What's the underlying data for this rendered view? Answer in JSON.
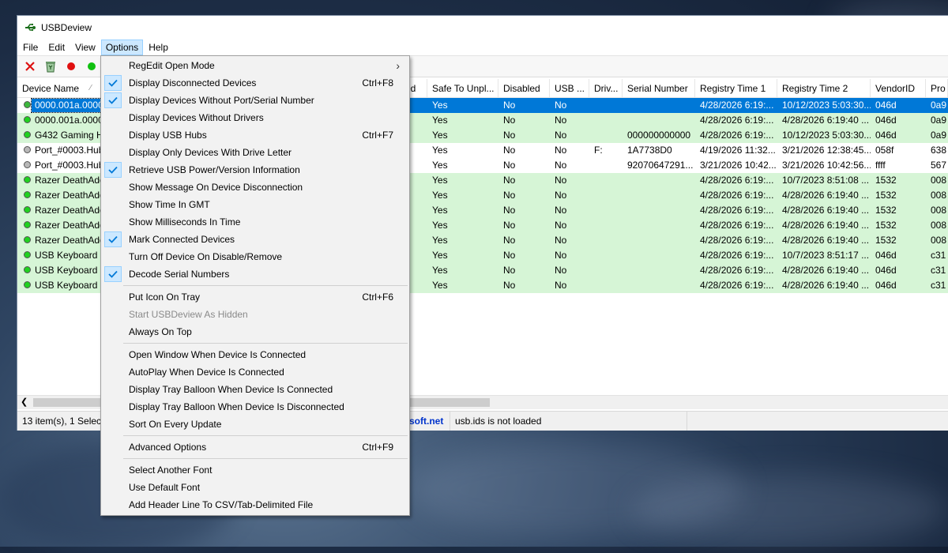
{
  "window": {
    "title": "USBDeview"
  },
  "menubar": [
    {
      "label": "File",
      "active": false
    },
    {
      "label": "Edit",
      "active": false
    },
    {
      "label": "View",
      "active": false
    },
    {
      "label": "Options",
      "active": true
    },
    {
      "label": "Help",
      "active": false
    }
  ],
  "columns": [
    {
      "label": "Device Name"
    },
    {
      "label": "ed"
    },
    {
      "label": "Safe To Unpl..."
    },
    {
      "label": "Disabled"
    },
    {
      "label": "USB ..."
    },
    {
      "label": "Driv..."
    },
    {
      "label": "Serial Number"
    },
    {
      "label": "Registry Time 1"
    },
    {
      "label": "Registry Time 2"
    },
    {
      "label": "VendorID"
    },
    {
      "label": "Pro"
    }
  ],
  "rows": [
    {
      "status": "green",
      "dot": "#3db83d",
      "name": "0000.001a.0000.",
      "safe": "Yes",
      "disabled": "No",
      "usb": "No",
      "drive": "",
      "serial": "",
      "rt1": "4/28/2026 6:19:...",
      "rt2": "10/12/2023 5:03:30...",
      "vid": "046d",
      "pid": "0a9",
      "selected": true
    },
    {
      "status": "green",
      "dot": "#1fd11f",
      "name": "0000.001a.0000.",
      "safe": "Yes",
      "disabled": "No",
      "usb": "No",
      "drive": "",
      "serial": "",
      "rt1": "4/28/2026 6:19:...",
      "rt2": "4/28/2026 6:19:40 ...",
      "vid": "046d",
      "pid": "0a9",
      "selected": false
    },
    {
      "status": "green",
      "dot": "#1fd11f",
      "name": "G432 Gaming H",
      "safe": "Yes",
      "disabled": "No",
      "usb": "No",
      "drive": "",
      "serial": "000000000000",
      "rt1": "4/28/2026 6:19:...",
      "rt2": "10/12/2023 5:03:30...",
      "vid": "046d",
      "pid": "0a9",
      "selected": false
    },
    {
      "status": "white",
      "dot": "#b8b8b8",
      "name": "Port_#0003.Hub",
      "safe": "Yes",
      "disabled": "No",
      "usb": "No",
      "drive": "F:",
      "serial": "1A7738D0",
      "rt1": "4/19/2026 11:32...",
      "rt2": "3/21/2026 12:38:45...",
      "vid": "058f",
      "pid": "638",
      "selected": false
    },
    {
      "status": "white",
      "dot": "#b8b8b8",
      "name": "Port_#0003.Hub",
      "safe": "Yes",
      "disabled": "No",
      "usb": "No",
      "drive": "",
      "serial": "92070647291...",
      "rt1": "3/21/2026 10:42...",
      "rt2": "3/21/2026 10:42:56...",
      "vid": "ffff",
      "pid": "567",
      "selected": false
    },
    {
      "status": "green",
      "dot": "#1fd11f",
      "name": "Razer DeathAdd",
      "safe": "Yes",
      "disabled": "No",
      "usb": "No",
      "drive": "",
      "serial": "",
      "rt1": "4/28/2026 6:19:...",
      "rt2": "10/7/2023 8:51:08 ...",
      "vid": "1532",
      "pid": "008",
      "selected": false
    },
    {
      "status": "green",
      "dot": "#1fd11f",
      "name": "Razer DeathAdd",
      "safe": "Yes",
      "disabled": "No",
      "usb": "No",
      "drive": "",
      "serial": "",
      "rt1": "4/28/2026 6:19:...",
      "rt2": "4/28/2026 6:19:40 ...",
      "vid": "1532",
      "pid": "008",
      "selected": false
    },
    {
      "status": "green",
      "dot": "#1fd11f",
      "name": "Razer DeathAdd",
      "safe": "Yes",
      "disabled": "No",
      "usb": "No",
      "drive": "",
      "serial": "",
      "rt1": "4/28/2026 6:19:...",
      "rt2": "4/28/2026 6:19:40 ...",
      "vid": "1532",
      "pid": "008",
      "selected": false
    },
    {
      "status": "green",
      "dot": "#1fd11f",
      "name": "Razer DeathAdd",
      "safe": "Yes",
      "disabled": "No",
      "usb": "No",
      "drive": "",
      "serial": "",
      "rt1": "4/28/2026 6:19:...",
      "rt2": "4/28/2026 6:19:40 ...",
      "vid": "1532",
      "pid": "008",
      "selected": false
    },
    {
      "status": "green",
      "dot": "#1fd11f",
      "name": "Razer DeathAdd",
      "safe": "Yes",
      "disabled": "No",
      "usb": "No",
      "drive": "",
      "serial": "",
      "rt1": "4/28/2026 6:19:...",
      "rt2": "4/28/2026 6:19:40 ...",
      "vid": "1532",
      "pid": "008",
      "selected": false
    },
    {
      "status": "green",
      "dot": "#1fd11f",
      "name": "USB Keyboard",
      "safe": "Yes",
      "disabled": "No",
      "usb": "No",
      "drive": "",
      "serial": "",
      "rt1": "4/28/2026 6:19:...",
      "rt2": "10/7/2023 8:51:17 ...",
      "vid": "046d",
      "pid": "c31",
      "selected": false
    },
    {
      "status": "green",
      "dot": "#1fd11f",
      "name": "USB Keyboard",
      "safe": "Yes",
      "disabled": "No",
      "usb": "No",
      "drive": "",
      "serial": "",
      "rt1": "4/28/2026 6:19:...",
      "rt2": "4/28/2026 6:19:40 ...",
      "vid": "046d",
      "pid": "c31",
      "selected": false
    },
    {
      "status": "green",
      "dot": "#1fd11f",
      "name": "USB Keyboard",
      "safe": "Yes",
      "disabled": "No",
      "usb": "No",
      "drive": "",
      "serial": "",
      "rt1": "4/28/2026 6:19:...",
      "rt2": "4/28/2026 6:19:40 ...",
      "vid": "046d",
      "pid": "c31",
      "selected": false
    }
  ],
  "statusbar": {
    "items_text": "13 item(s), 1 Selecte",
    "link_text": "soft.net",
    "usbids_text": "usb.ids is not loaded"
  },
  "options_menu": [
    {
      "type": "item",
      "label": "RegEdit Open Mode",
      "shortcut": "",
      "checked": false,
      "submenu": true,
      "disabled": false
    },
    {
      "type": "item",
      "label": "Display Disconnected Devices",
      "shortcut": "Ctrl+F8",
      "checked": true,
      "submenu": false,
      "disabled": false
    },
    {
      "type": "item",
      "label": "Display Devices Without Port/Serial Number",
      "shortcut": "",
      "checked": true,
      "submenu": false,
      "disabled": false
    },
    {
      "type": "item",
      "label": "Display Devices Without Drivers",
      "shortcut": "",
      "checked": false,
      "submenu": false,
      "disabled": false
    },
    {
      "type": "item",
      "label": "Display USB Hubs",
      "shortcut": "Ctrl+F7",
      "checked": false,
      "submenu": false,
      "disabled": false
    },
    {
      "type": "item",
      "label": "Display Only Devices With Drive Letter",
      "shortcut": "",
      "checked": false,
      "submenu": false,
      "disabled": false
    },
    {
      "type": "item",
      "label": "Retrieve USB Power/Version Information",
      "shortcut": "",
      "checked": true,
      "submenu": false,
      "disabled": false
    },
    {
      "type": "item",
      "label": "Show Message On Device Disconnection",
      "shortcut": "",
      "checked": false,
      "submenu": false,
      "disabled": false
    },
    {
      "type": "item",
      "label": "Show Time In GMT",
      "shortcut": "",
      "checked": false,
      "submenu": false,
      "disabled": false
    },
    {
      "type": "item",
      "label": "Show Milliseconds In Time",
      "shortcut": "",
      "checked": false,
      "submenu": false,
      "disabled": false
    },
    {
      "type": "item",
      "label": "Mark Connected Devices",
      "shortcut": "",
      "checked": true,
      "submenu": false,
      "disabled": false
    },
    {
      "type": "item",
      "label": "Turn Off Device On Disable/Remove",
      "shortcut": "",
      "checked": false,
      "submenu": false,
      "disabled": false
    },
    {
      "type": "item",
      "label": "Decode Serial Numbers",
      "shortcut": "",
      "checked": true,
      "submenu": false,
      "disabled": false
    },
    {
      "type": "sep"
    },
    {
      "type": "item",
      "label": "Put Icon On Tray",
      "shortcut": "Ctrl+F6",
      "checked": false,
      "submenu": false,
      "disabled": false
    },
    {
      "type": "item",
      "label": "Start USBDeview As Hidden",
      "shortcut": "",
      "checked": false,
      "submenu": false,
      "disabled": true
    },
    {
      "type": "item",
      "label": "Always On Top",
      "shortcut": "",
      "checked": false,
      "submenu": false,
      "disabled": false
    },
    {
      "type": "sep"
    },
    {
      "type": "item",
      "label": "Open Window When Device Is Connected",
      "shortcut": "",
      "checked": false,
      "submenu": false,
      "disabled": false
    },
    {
      "type": "item",
      "label": "AutoPlay When Device Is Connected",
      "shortcut": "",
      "checked": false,
      "submenu": false,
      "disabled": false
    },
    {
      "type": "item",
      "label": "Display Tray Balloon When Device Is Connected",
      "shortcut": "",
      "checked": false,
      "submenu": false,
      "disabled": false
    },
    {
      "type": "item",
      "label": "Display Tray Balloon When Device Is Disconnected",
      "shortcut": "",
      "checked": false,
      "submenu": false,
      "disabled": false
    },
    {
      "type": "item",
      "label": "Sort On Every Update",
      "shortcut": "",
      "checked": false,
      "submenu": false,
      "disabled": false
    },
    {
      "type": "sep"
    },
    {
      "type": "item",
      "label": "Advanced Options",
      "shortcut": "Ctrl+F9",
      "checked": false,
      "submenu": false,
      "disabled": false
    },
    {
      "type": "sep"
    },
    {
      "type": "item",
      "label": "Select Another Font",
      "shortcut": "",
      "checked": false,
      "submenu": false,
      "disabled": false
    },
    {
      "type": "item",
      "label": "Use Default Font",
      "shortcut": "",
      "checked": false,
      "submenu": false,
      "disabled": false
    },
    {
      "type": "item",
      "label": "Add Header Line To CSV/Tab-Delimited File",
      "shortcut": "",
      "checked": false,
      "submenu": false,
      "disabled": false
    }
  ],
  "colors": {
    "selected_row": "#0078d7",
    "connected_row": "#d6f5d6",
    "menu_highlight": "#cce8ff",
    "check_color": "#0078d7",
    "link_color": "#0033cc"
  },
  "icons": [
    "usb-app-icon",
    "remove-x-icon",
    "recycle-icon",
    "red-dot-icon",
    "green-dot-icon",
    "checkmark-icon",
    "submenu-arrow-icon",
    "scroll-left-icon"
  ]
}
